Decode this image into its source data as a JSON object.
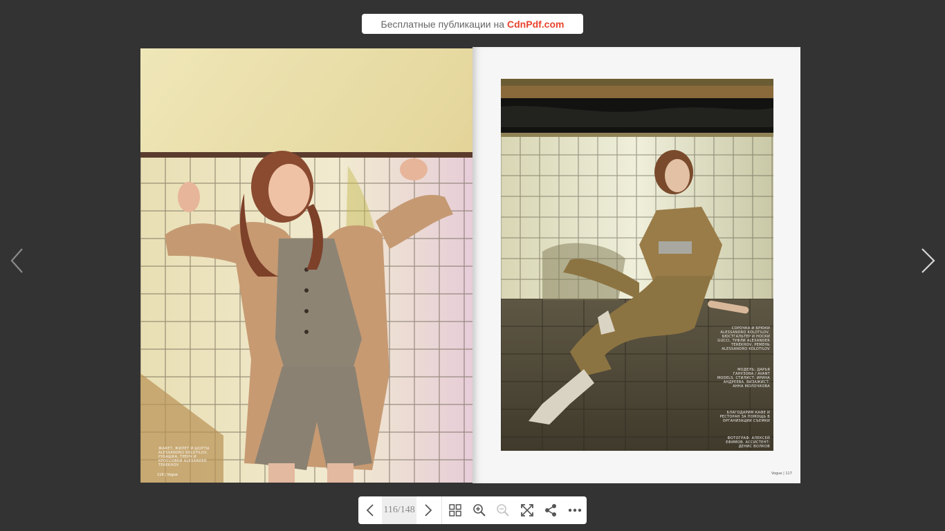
{
  "banner": {
    "text": "Бесплатные публикации на",
    "brand": "CdnPdf.com"
  },
  "viewer": {
    "page_indicator": "116/148"
  },
  "left_page": {
    "caption": "Жакет, жилет и шорты Alessandro Kolotilov, рубашка, тренч и кроссовки Alexander Terekhov",
    "folio": "116 | Vogue"
  },
  "right_page": {
    "caption_1": "Сорочка и брюки Alessandro Kolotilov, бюстгальтер и носки Gucci, туфли Alexander Terekhov, ремень Alessandro Kolotilov",
    "caption_2": "Модель: Дарья Ганузова / Avant Models. Стилист: Ирина Андреева. Визажист: Анна Молочкова",
    "caption_3": "Благодарим кафе и ресторан за помощь в организации съемки",
    "caption_4": "Фотограф: Алексей Ефимов. Ассистент: Денис Волков",
    "folio": "Vogue | 117"
  },
  "icons": {
    "prev_side": "chevron-left-icon",
    "next_side": "chevron-right-icon",
    "thumbnails": "grid-icon",
    "zoom_in": "zoom-in-icon",
    "zoom_out": "zoom-out-icon",
    "fullscreen": "fullscreen-icon",
    "share": "share-icon",
    "more": "more-icon"
  },
  "colors": {
    "background": "#333333",
    "brand": "#e8432d",
    "toolbar_icon": "#555555"
  }
}
